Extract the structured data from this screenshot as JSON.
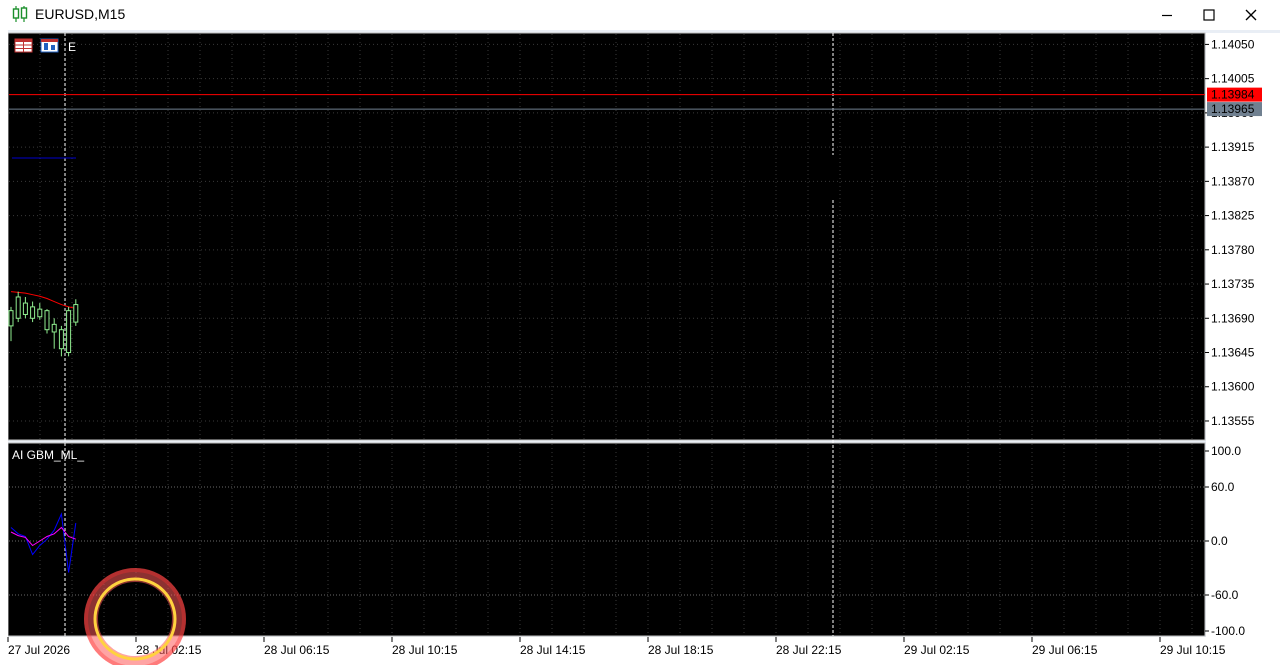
{
  "window": {
    "title": "EURUSD,M15",
    "icon": "candlestick-chart-icon",
    "controls": [
      "minimize-icon",
      "maximize-icon",
      "close-icon"
    ]
  },
  "colors": {
    "background": "#000000",
    "grid": "#3a3a3a",
    "bull_candle": "#90ee90",
    "ask_line": "#ff0000",
    "bid_line": "#708090",
    "axis_text": "#000000",
    "ma_line": "#ff0000",
    "indicator_main": "#0000ff",
    "indicator_signal": "#ff00ff"
  },
  "toolbar": {
    "trade_label": "E"
  },
  "price_axis": {
    "labels": [
      "1.14050",
      "1.14005",
      "1.13960",
      "1.13915",
      "1.13870",
      "1.13825",
      "1.13780",
      "1.13735",
      "1.13690",
      "1.13645",
      "1.13600",
      "1.13555"
    ],
    "ask_label": "1.13984",
    "bid_label": "1.13965"
  },
  "indicator": {
    "name": "AI GBM_ML_",
    "levels": [
      "100.0",
      "60.0",
      "0.0",
      "-60.0",
      "-100.0"
    ]
  },
  "time_axis": {
    "labels": [
      "27 Jul 2026",
      "28 Jul 02:15",
      "28 Jul 06:15",
      "28 Jul 10:15",
      "28 Jul 14:15",
      "28 Jul 18:15",
      "28 Jul 22:15",
      "29 Jul 02:15",
      "29 Jul 06:15",
      "29 Jul 10:15"
    ]
  },
  "chart_data": {
    "type": "candlestick",
    "symbol": "EURUSD",
    "timeframe": "M15",
    "ylim": [
      1.1353,
      1.14065
    ],
    "candles": [
      {
        "o": 1.1368,
        "h": 1.13705,
        "l": 1.1366,
        "c": 1.137
      },
      {
        "o": 1.1369,
        "h": 1.13725,
        "l": 1.13685,
        "c": 1.13718
      },
      {
        "o": 1.13695,
        "h": 1.13718,
        "l": 1.1369,
        "c": 1.1371
      },
      {
        "o": 1.1369,
        "h": 1.13712,
        "l": 1.13685,
        "c": 1.13705
      },
      {
        "o": 1.13692,
        "h": 1.1371,
        "l": 1.13688,
        "c": 1.13702
      },
      {
        "o": 1.13675,
        "h": 1.13702,
        "l": 1.1367,
        "c": 1.137
      },
      {
        "o": 1.13672,
        "h": 1.1369,
        "l": 1.1365,
        "c": 1.13682
      },
      {
        "o": 1.1365,
        "h": 1.1368,
        "l": 1.1364,
        "c": 1.13675
      },
      {
        "o": 1.13645,
        "h": 1.13705,
        "l": 1.1364,
        "c": 1.137
      },
      {
        "o": 1.13685,
        "h": 1.13715,
        "l": 1.1368,
        "c": 1.13708
      }
    ],
    "ma": [
      1.13725,
      1.13724,
      1.13723,
      1.13721,
      1.13719,
      1.13716,
      1.13712,
      1.13708,
      1.13705,
      1.13703
    ],
    "ask": 1.13984,
    "bid": 1.13965,
    "indicator_series": [
      {
        "values": [
          15,
          8,
          5,
          -15,
          -5,
          2,
          12,
          30,
          -35,
          20
        ]
      },
      {
        "values": [
          10,
          6,
          4,
          -5,
          0,
          5,
          8,
          15,
          5,
          2
        ]
      }
    ],
    "indicator_ylim": [
      -100,
      100
    ],
    "indicator_levels": [
      60,
      0,
      -60
    ]
  }
}
